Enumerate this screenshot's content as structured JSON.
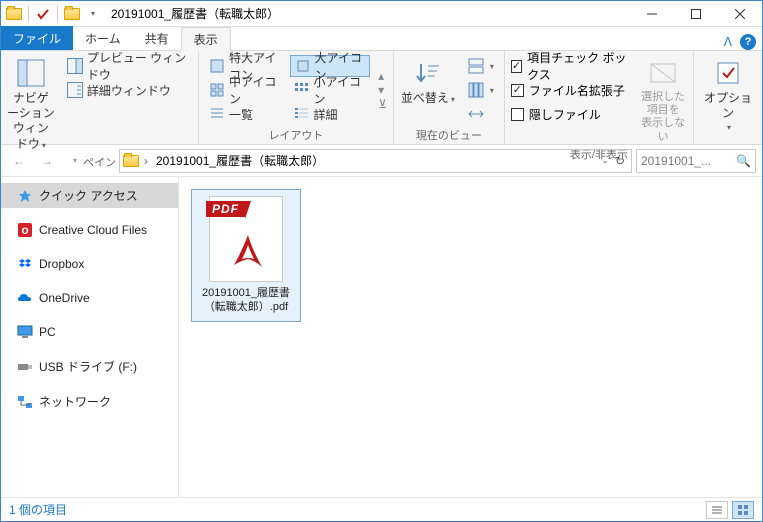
{
  "window": {
    "title": "20191001_履歴書（転職太郎）"
  },
  "tabs": {
    "file": "ファイル",
    "home": "ホーム",
    "share": "共有",
    "view": "表示"
  },
  "ribbon": {
    "pane": {
      "navigation": "ナビゲーション\nウィンドウ",
      "preview": "プレビュー ウィンドウ",
      "details": "詳細ウィンドウ",
      "group_label": "ペイン"
    },
    "layout": {
      "extra_large": "特大アイコン",
      "large": "大アイコン",
      "medium": "中アイコン",
      "small": "小アイコン",
      "list": "一覧",
      "details": "詳細",
      "group_label": "レイアウト"
    },
    "current_view": {
      "sort": "並べ替え",
      "group_label": "現在のビュー"
    },
    "show_hide": {
      "item_checkboxes": "項目チェック ボックス",
      "file_extensions": "ファイル名拡張子",
      "hidden_files": "隠しファイル",
      "hide_selected": "選択した項目を\n表示しない",
      "group_label": "表示/非表示"
    },
    "options": {
      "options": "オプション",
      "group_label": ""
    }
  },
  "address": {
    "folder": "20191001_履歴書（転職太郎）",
    "search_placeholder": "20191001_..."
  },
  "sidebar": {
    "items": [
      {
        "label": "クイック アクセス",
        "icon": "star",
        "selected": true
      },
      {
        "label": "Creative Cloud Files",
        "icon": "cc"
      },
      {
        "label": "Dropbox",
        "icon": "dropbox"
      },
      {
        "label": "OneDrive",
        "icon": "onedrive"
      },
      {
        "label": "PC",
        "icon": "pc"
      },
      {
        "label": "USB ドライブ (F:)",
        "icon": "usb"
      },
      {
        "label": "ネットワーク",
        "icon": "network"
      }
    ]
  },
  "files": [
    {
      "name": "20191001_履歴書（転職太郎）.pdf",
      "type": "pdf"
    }
  ],
  "status": {
    "count": "1 個の項目"
  }
}
